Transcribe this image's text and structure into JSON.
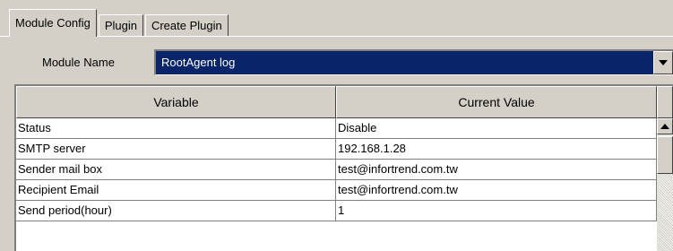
{
  "tabs": [
    {
      "label": "Module Config",
      "active": true
    },
    {
      "label": "Plugin",
      "active": false
    },
    {
      "label": "Create Plugin",
      "active": false
    }
  ],
  "module": {
    "label": "Module Name",
    "selected": "RootAgent log"
  },
  "table": {
    "columns": [
      "Variable",
      "Current Value"
    ],
    "rows": [
      [
        "Status",
        "Disable"
      ],
      [
        "SMTP server",
        "192.168.1.28"
      ],
      [
        "Sender mail box",
        "test@infortrend.com.tw"
      ],
      [
        "Recipient Email",
        "test@infortrend.com.tw"
      ],
      [
        "Send period(hour)",
        "1"
      ]
    ]
  },
  "colors": {
    "window": "#d4d0c8",
    "selection": "#0a246a"
  },
  "icons": {
    "dropdown": "chevron-down-icon",
    "scroll_up": "arrow-up-icon"
  }
}
